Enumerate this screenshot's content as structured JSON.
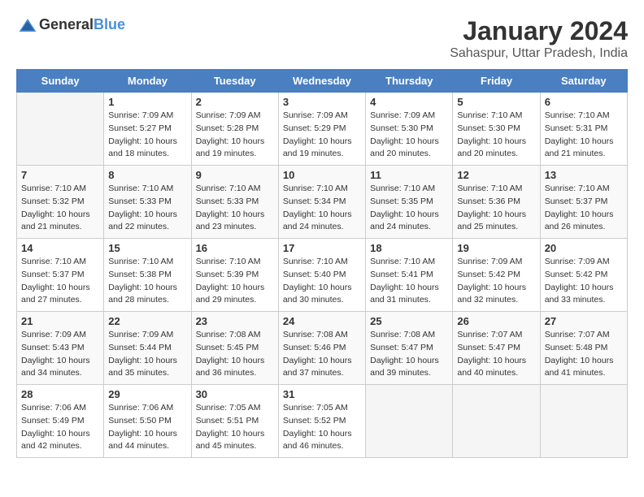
{
  "header": {
    "logo_general": "General",
    "logo_blue": "Blue",
    "title": "January 2024",
    "subtitle": "Sahaspur, Uttar Pradesh, India"
  },
  "days_of_week": [
    "Sunday",
    "Monday",
    "Tuesday",
    "Wednesday",
    "Thursday",
    "Friday",
    "Saturday"
  ],
  "weeks": [
    [
      {
        "day": "",
        "info": ""
      },
      {
        "day": "1",
        "info": "Sunrise: 7:09 AM\nSunset: 5:27 PM\nDaylight: 10 hours\nand 18 minutes."
      },
      {
        "day": "2",
        "info": "Sunrise: 7:09 AM\nSunset: 5:28 PM\nDaylight: 10 hours\nand 19 minutes."
      },
      {
        "day": "3",
        "info": "Sunrise: 7:09 AM\nSunset: 5:29 PM\nDaylight: 10 hours\nand 19 minutes."
      },
      {
        "day": "4",
        "info": "Sunrise: 7:09 AM\nSunset: 5:30 PM\nDaylight: 10 hours\nand 20 minutes."
      },
      {
        "day": "5",
        "info": "Sunrise: 7:10 AM\nSunset: 5:30 PM\nDaylight: 10 hours\nand 20 minutes."
      },
      {
        "day": "6",
        "info": "Sunrise: 7:10 AM\nSunset: 5:31 PM\nDaylight: 10 hours\nand 21 minutes."
      }
    ],
    [
      {
        "day": "7",
        "info": "Sunrise: 7:10 AM\nSunset: 5:32 PM\nDaylight: 10 hours\nand 21 minutes."
      },
      {
        "day": "8",
        "info": "Sunrise: 7:10 AM\nSunset: 5:33 PM\nDaylight: 10 hours\nand 22 minutes."
      },
      {
        "day": "9",
        "info": "Sunrise: 7:10 AM\nSunset: 5:33 PM\nDaylight: 10 hours\nand 23 minutes."
      },
      {
        "day": "10",
        "info": "Sunrise: 7:10 AM\nSunset: 5:34 PM\nDaylight: 10 hours\nand 24 minutes."
      },
      {
        "day": "11",
        "info": "Sunrise: 7:10 AM\nSunset: 5:35 PM\nDaylight: 10 hours\nand 24 minutes."
      },
      {
        "day": "12",
        "info": "Sunrise: 7:10 AM\nSunset: 5:36 PM\nDaylight: 10 hours\nand 25 minutes."
      },
      {
        "day": "13",
        "info": "Sunrise: 7:10 AM\nSunset: 5:37 PM\nDaylight: 10 hours\nand 26 minutes."
      }
    ],
    [
      {
        "day": "14",
        "info": "Sunrise: 7:10 AM\nSunset: 5:37 PM\nDaylight: 10 hours\nand 27 minutes."
      },
      {
        "day": "15",
        "info": "Sunrise: 7:10 AM\nSunset: 5:38 PM\nDaylight: 10 hours\nand 28 minutes."
      },
      {
        "day": "16",
        "info": "Sunrise: 7:10 AM\nSunset: 5:39 PM\nDaylight: 10 hours\nand 29 minutes."
      },
      {
        "day": "17",
        "info": "Sunrise: 7:10 AM\nSunset: 5:40 PM\nDaylight: 10 hours\nand 30 minutes."
      },
      {
        "day": "18",
        "info": "Sunrise: 7:10 AM\nSunset: 5:41 PM\nDaylight: 10 hours\nand 31 minutes."
      },
      {
        "day": "19",
        "info": "Sunrise: 7:09 AM\nSunset: 5:42 PM\nDaylight: 10 hours\nand 32 minutes."
      },
      {
        "day": "20",
        "info": "Sunrise: 7:09 AM\nSunset: 5:42 PM\nDaylight: 10 hours\nand 33 minutes."
      }
    ],
    [
      {
        "day": "21",
        "info": "Sunrise: 7:09 AM\nSunset: 5:43 PM\nDaylight: 10 hours\nand 34 minutes."
      },
      {
        "day": "22",
        "info": "Sunrise: 7:09 AM\nSunset: 5:44 PM\nDaylight: 10 hours\nand 35 minutes."
      },
      {
        "day": "23",
        "info": "Sunrise: 7:08 AM\nSunset: 5:45 PM\nDaylight: 10 hours\nand 36 minutes."
      },
      {
        "day": "24",
        "info": "Sunrise: 7:08 AM\nSunset: 5:46 PM\nDaylight: 10 hours\nand 37 minutes."
      },
      {
        "day": "25",
        "info": "Sunrise: 7:08 AM\nSunset: 5:47 PM\nDaylight: 10 hours\nand 39 minutes."
      },
      {
        "day": "26",
        "info": "Sunrise: 7:07 AM\nSunset: 5:47 PM\nDaylight: 10 hours\nand 40 minutes."
      },
      {
        "day": "27",
        "info": "Sunrise: 7:07 AM\nSunset: 5:48 PM\nDaylight: 10 hours\nand 41 minutes."
      }
    ],
    [
      {
        "day": "28",
        "info": "Sunrise: 7:06 AM\nSunset: 5:49 PM\nDaylight: 10 hours\nand 42 minutes."
      },
      {
        "day": "29",
        "info": "Sunrise: 7:06 AM\nSunset: 5:50 PM\nDaylight: 10 hours\nand 44 minutes."
      },
      {
        "day": "30",
        "info": "Sunrise: 7:05 AM\nSunset: 5:51 PM\nDaylight: 10 hours\nand 45 minutes."
      },
      {
        "day": "31",
        "info": "Sunrise: 7:05 AM\nSunset: 5:52 PM\nDaylight: 10 hours\nand 46 minutes."
      },
      {
        "day": "",
        "info": ""
      },
      {
        "day": "",
        "info": ""
      },
      {
        "day": "",
        "info": ""
      }
    ]
  ]
}
